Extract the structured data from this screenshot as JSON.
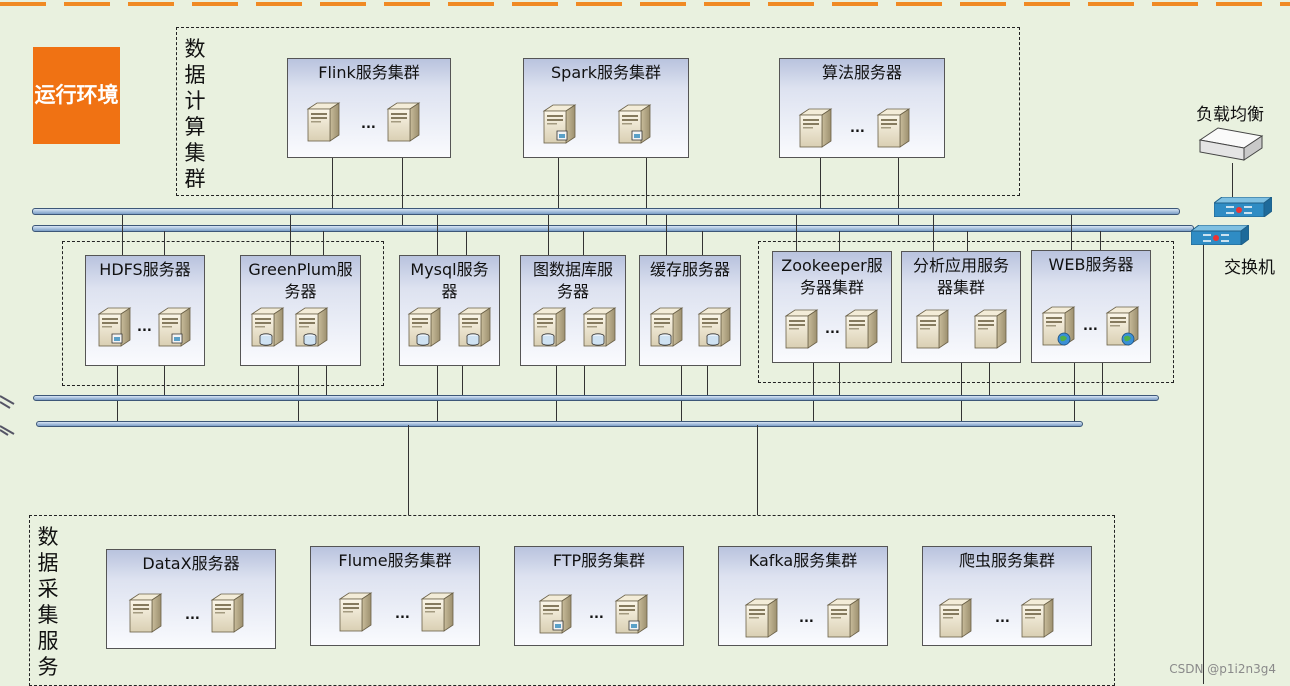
{
  "environment_label": "运行环境",
  "compute_group_label": "数据计算集群",
  "collect_group_label": "数据采集服务",
  "compute_clusters": [
    {
      "title": "Flink服务集群"
    },
    {
      "title": "Spark服务集群"
    },
    {
      "title": "算法服务器"
    }
  ],
  "storage_servers": [
    {
      "title": "HDFS服务器"
    },
    {
      "title": "GreenPlum服务器"
    },
    {
      "title": "Mysql服务器"
    },
    {
      "title": "图数据库服务器"
    },
    {
      "title": "缓存服务器"
    },
    {
      "title": "Zookeeper服务器集群"
    },
    {
      "title": "分析应用服务器集群"
    },
    {
      "title": "WEB服务器"
    }
  ],
  "collect_clusters": [
    {
      "title": "DataX服务器"
    },
    {
      "title": "Flume服务集群"
    },
    {
      "title": "FTP服务集群"
    },
    {
      "title": "Kafka服务集群"
    },
    {
      "title": "爬虫服务集群"
    }
  ],
  "ellipsis": "...",
  "load_balancer_label": "负载均衡",
  "switch_label": "交换机",
  "watermark": "CSDN @p1i2n3g4",
  "colors": {
    "environment_bg": "#f07213",
    "background": "#e9f1df",
    "top_dash": "#f08a24",
    "box_gradient_top": "#b9c3de",
    "box_gradient_bottom": "#fafbfe"
  }
}
